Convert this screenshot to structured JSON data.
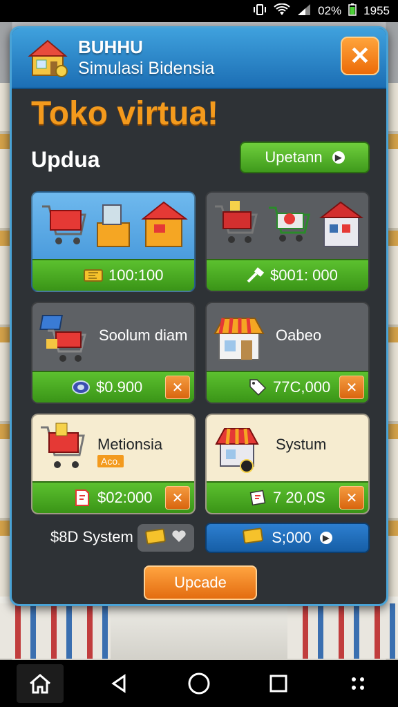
{
  "status_bar": {
    "icons": [
      "vibrate-icon",
      "wifi-icon",
      "signal-icon",
      "battery-icon"
    ],
    "battery": "02%",
    "time": "1955"
  },
  "panel": {
    "title": "BUHHU",
    "subtitle": "Simulasi Bidensia",
    "close_label": "✕",
    "heading": "Toko virtua!",
    "section": "Updua",
    "top_button": "Upetann"
  },
  "cards": [
    {
      "price": "100:100",
      "icon": "ticket-icon"
    },
    {
      "price": "$001: 000",
      "icon": "hammer-icon"
    },
    {
      "label": "Soolum diam",
      "price": "$0.900",
      "icon": "coin-icon"
    },
    {
      "label": "Oabeo",
      "price": "77С,000",
      "icon": "tag-icon"
    },
    {
      "label": "Metionsia",
      "badge": "Aco.",
      "price": "$02:000",
      "icon": "receipt-icon"
    },
    {
      "label": "Systum",
      "price": "7 20,0S",
      "icon": "document-icon"
    }
  ],
  "bottom": {
    "system_label": "$8D System",
    "blue_button": "S;000",
    "upgrade_button": "Upcade"
  },
  "colors": {
    "accent_orange": "#f39a1d",
    "panel_bg": "#2e3236",
    "header_blue": "#2e86cc",
    "green": "#4caf23"
  }
}
